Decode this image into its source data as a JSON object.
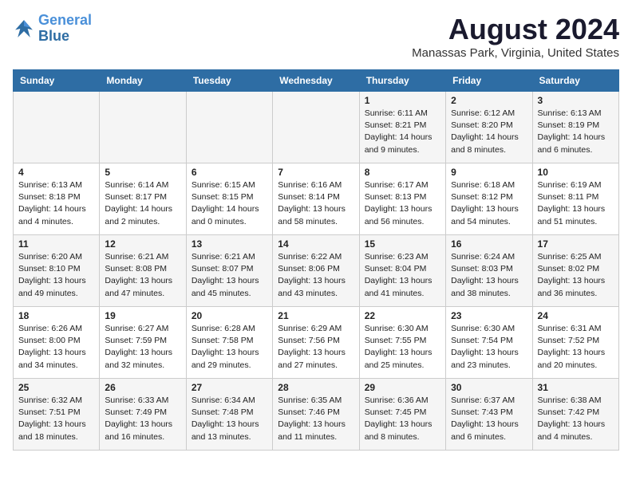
{
  "logo": {
    "line1": "General",
    "line2": "Blue"
  },
  "title": "August 2024",
  "subtitle": "Manassas Park, Virginia, United States",
  "headers": [
    "Sunday",
    "Monday",
    "Tuesday",
    "Wednesday",
    "Thursday",
    "Friday",
    "Saturday"
  ],
  "weeks": [
    [
      {
        "day": "",
        "info": ""
      },
      {
        "day": "",
        "info": ""
      },
      {
        "day": "",
        "info": ""
      },
      {
        "day": "",
        "info": ""
      },
      {
        "day": "1",
        "info": "Sunrise: 6:11 AM\nSunset: 8:21 PM\nDaylight: 14 hours and 9 minutes."
      },
      {
        "day": "2",
        "info": "Sunrise: 6:12 AM\nSunset: 8:20 PM\nDaylight: 14 hours and 8 minutes."
      },
      {
        "day": "3",
        "info": "Sunrise: 6:13 AM\nSunset: 8:19 PM\nDaylight: 14 hours and 6 minutes."
      }
    ],
    [
      {
        "day": "4",
        "info": "Sunrise: 6:13 AM\nSunset: 8:18 PM\nDaylight: 14 hours and 4 minutes."
      },
      {
        "day": "5",
        "info": "Sunrise: 6:14 AM\nSunset: 8:17 PM\nDaylight: 14 hours and 2 minutes."
      },
      {
        "day": "6",
        "info": "Sunrise: 6:15 AM\nSunset: 8:15 PM\nDaylight: 14 hours and 0 minutes."
      },
      {
        "day": "7",
        "info": "Sunrise: 6:16 AM\nSunset: 8:14 PM\nDaylight: 13 hours and 58 minutes."
      },
      {
        "day": "8",
        "info": "Sunrise: 6:17 AM\nSunset: 8:13 PM\nDaylight: 13 hours and 56 minutes."
      },
      {
        "day": "9",
        "info": "Sunrise: 6:18 AM\nSunset: 8:12 PM\nDaylight: 13 hours and 54 minutes."
      },
      {
        "day": "10",
        "info": "Sunrise: 6:19 AM\nSunset: 8:11 PM\nDaylight: 13 hours and 51 minutes."
      }
    ],
    [
      {
        "day": "11",
        "info": "Sunrise: 6:20 AM\nSunset: 8:10 PM\nDaylight: 13 hours and 49 minutes."
      },
      {
        "day": "12",
        "info": "Sunrise: 6:21 AM\nSunset: 8:08 PM\nDaylight: 13 hours and 47 minutes."
      },
      {
        "day": "13",
        "info": "Sunrise: 6:21 AM\nSunset: 8:07 PM\nDaylight: 13 hours and 45 minutes."
      },
      {
        "day": "14",
        "info": "Sunrise: 6:22 AM\nSunset: 8:06 PM\nDaylight: 13 hours and 43 minutes."
      },
      {
        "day": "15",
        "info": "Sunrise: 6:23 AM\nSunset: 8:04 PM\nDaylight: 13 hours and 41 minutes."
      },
      {
        "day": "16",
        "info": "Sunrise: 6:24 AM\nSunset: 8:03 PM\nDaylight: 13 hours and 38 minutes."
      },
      {
        "day": "17",
        "info": "Sunrise: 6:25 AM\nSunset: 8:02 PM\nDaylight: 13 hours and 36 minutes."
      }
    ],
    [
      {
        "day": "18",
        "info": "Sunrise: 6:26 AM\nSunset: 8:00 PM\nDaylight: 13 hours and 34 minutes."
      },
      {
        "day": "19",
        "info": "Sunrise: 6:27 AM\nSunset: 7:59 PM\nDaylight: 13 hours and 32 minutes."
      },
      {
        "day": "20",
        "info": "Sunrise: 6:28 AM\nSunset: 7:58 PM\nDaylight: 13 hours and 29 minutes."
      },
      {
        "day": "21",
        "info": "Sunrise: 6:29 AM\nSunset: 7:56 PM\nDaylight: 13 hours and 27 minutes."
      },
      {
        "day": "22",
        "info": "Sunrise: 6:30 AM\nSunset: 7:55 PM\nDaylight: 13 hours and 25 minutes."
      },
      {
        "day": "23",
        "info": "Sunrise: 6:30 AM\nSunset: 7:54 PM\nDaylight: 13 hours and 23 minutes."
      },
      {
        "day": "24",
        "info": "Sunrise: 6:31 AM\nSunset: 7:52 PM\nDaylight: 13 hours and 20 minutes."
      }
    ],
    [
      {
        "day": "25",
        "info": "Sunrise: 6:32 AM\nSunset: 7:51 PM\nDaylight: 13 hours and 18 minutes."
      },
      {
        "day": "26",
        "info": "Sunrise: 6:33 AM\nSunset: 7:49 PM\nDaylight: 13 hours and 16 minutes."
      },
      {
        "day": "27",
        "info": "Sunrise: 6:34 AM\nSunset: 7:48 PM\nDaylight: 13 hours and 13 minutes."
      },
      {
        "day": "28",
        "info": "Sunrise: 6:35 AM\nSunset: 7:46 PM\nDaylight: 13 hours and 11 minutes."
      },
      {
        "day": "29",
        "info": "Sunrise: 6:36 AM\nSunset: 7:45 PM\nDaylight: 13 hours and 8 minutes."
      },
      {
        "day": "30",
        "info": "Sunrise: 6:37 AM\nSunset: 7:43 PM\nDaylight: 13 hours and 6 minutes."
      },
      {
        "day": "31",
        "info": "Sunrise: 6:38 AM\nSunset: 7:42 PM\nDaylight: 13 hours and 4 minutes."
      }
    ]
  ]
}
